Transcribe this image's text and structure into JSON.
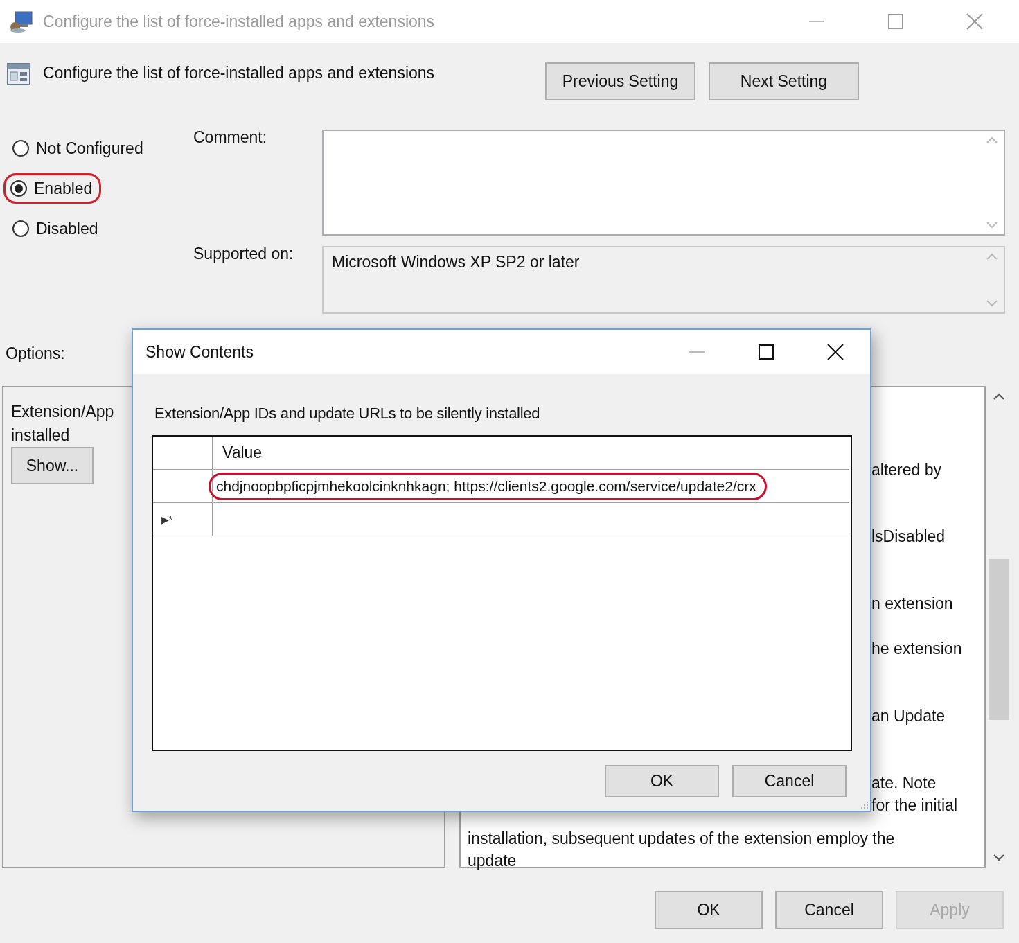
{
  "window": {
    "title": "Configure the list of force-installed apps and extensions"
  },
  "setting": {
    "title": "Configure the list of force-installed apps and extensions",
    "buttons": [
      "Previous Setting",
      "Next Setting"
    ]
  },
  "state_options": [
    {
      "label": "Not Configured",
      "selected": false,
      "highlighted": false
    },
    {
      "label": "Enabled",
      "selected": true,
      "highlighted": true
    },
    {
      "label": "Disabled",
      "selected": false,
      "highlighted": false
    }
  ],
  "comment": {
    "label": "Comment:"
  },
  "supported_on": {
    "label": "Supported on:",
    "value": "Microsoft Windows XP SP2 or later"
  },
  "options": {
    "label": "Options:",
    "lines": [
      "Extension/App",
      "installed"
    ],
    "button": "Show..."
  },
  "help": {
    "fragments": [
      "altered by",
      "lsDisabled",
      "n extension",
      "he extension",
      "an Update",
      "ate. Note",
      "for the initial"
    ],
    "lines": [
      "installation, subsequent updates of the extension employ the",
      "update"
    ]
  },
  "buttons": [
    {
      "label": "OK",
      "disabled": false
    },
    {
      "label": "Cancel",
      "disabled": false
    },
    {
      "label": "Apply",
      "disabled": true
    }
  ],
  "dialog": {
    "title": "Show Contents",
    "caption": "Extension/App IDs and update URLs to be silently installed",
    "columns": [
      "Value"
    ],
    "rows": [
      {
        "value": "chdjnoopbpficpjmhekoolcinknhkagn; https://clients2.google.com/service/update2/crx",
        "highlighted": true
      }
    ],
    "new_row_marker": "▶*",
    "buttons": [
      "OK",
      "Cancel"
    ]
  }
}
